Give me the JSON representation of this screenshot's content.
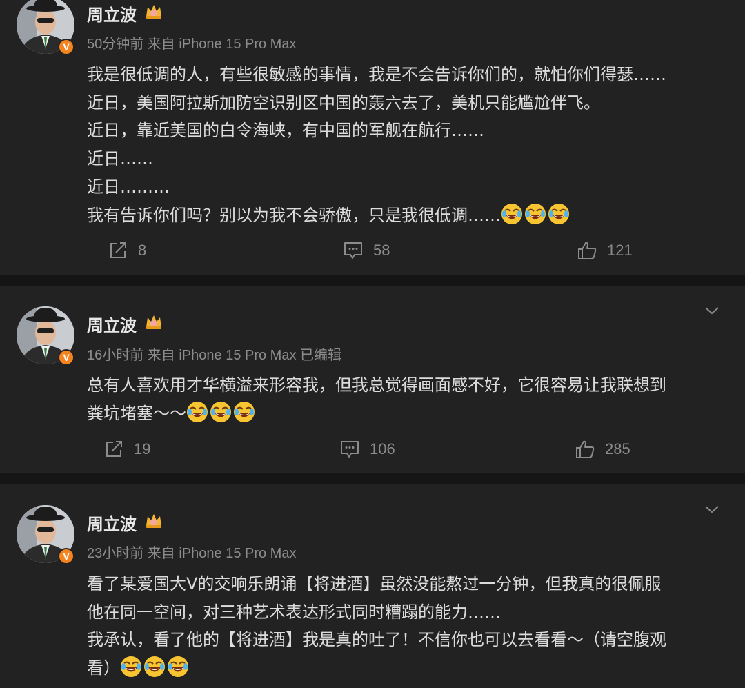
{
  "posts": [
    {
      "author": "周立波",
      "meta": "50分钟前  来自 iPhone 15 Pro Max",
      "lines": [
        "我是很低调的人，有些很敏感的事情，我是不会告诉你们的，就怕你们得瑟……",
        "近日，美国阿拉斯加防空识别区中国的轰六去了，美机只能尴尬伴飞。",
        "近日，靠近美国的白令海峡，有中国的军舰在航行……",
        "近日……",
        "近日………",
        "我有告诉你们吗？别以为我不会骄傲，只是我很低调……"
      ],
      "emoji": "laugh-cry-emoji",
      "reposts": "8",
      "comments": "58",
      "likes": "121"
    },
    {
      "author": "周立波",
      "meta": "16小时前  来自 iPhone 15 Pro Max  已编辑",
      "lines": [
        "总有人喜欢用才华横溢来形容我，但我总觉得画面感不好，它很容易让我联想到",
        "粪坑堵塞～～"
      ],
      "emoji": "laugh-cry-emoji",
      "reposts": "19",
      "comments": "106",
      "likes": "285"
    },
    {
      "author": "周立波",
      "meta": "23小时前  来自 iPhone 15 Pro Max",
      "lines": [
        "看了某爱国大V的交响乐朗诵【将进酒】虽然没能熬过一分钟，但我真的很佩服",
        "他在同一空间，对三种艺术表达形式同时糟蹋的能力……",
        "我承认，看了他的【将进酒】我是真的吐了！不信你也可以去看看～（请空腹观",
        "看）"
      ],
      "emoji": "laugh-cry-emoji"
    }
  ],
  "colors": {
    "page_bg": "#151515",
    "card_bg": "#222222",
    "text": "#dcdcdc",
    "meta": "#8c8c8c",
    "verified_badge": "#f5841f",
    "crown": "#f2b431"
  },
  "icons": [
    "repost-icon",
    "comment-icon",
    "like-icon",
    "chevron-down-icon",
    "crown-icon",
    "verified-v-icon"
  ]
}
